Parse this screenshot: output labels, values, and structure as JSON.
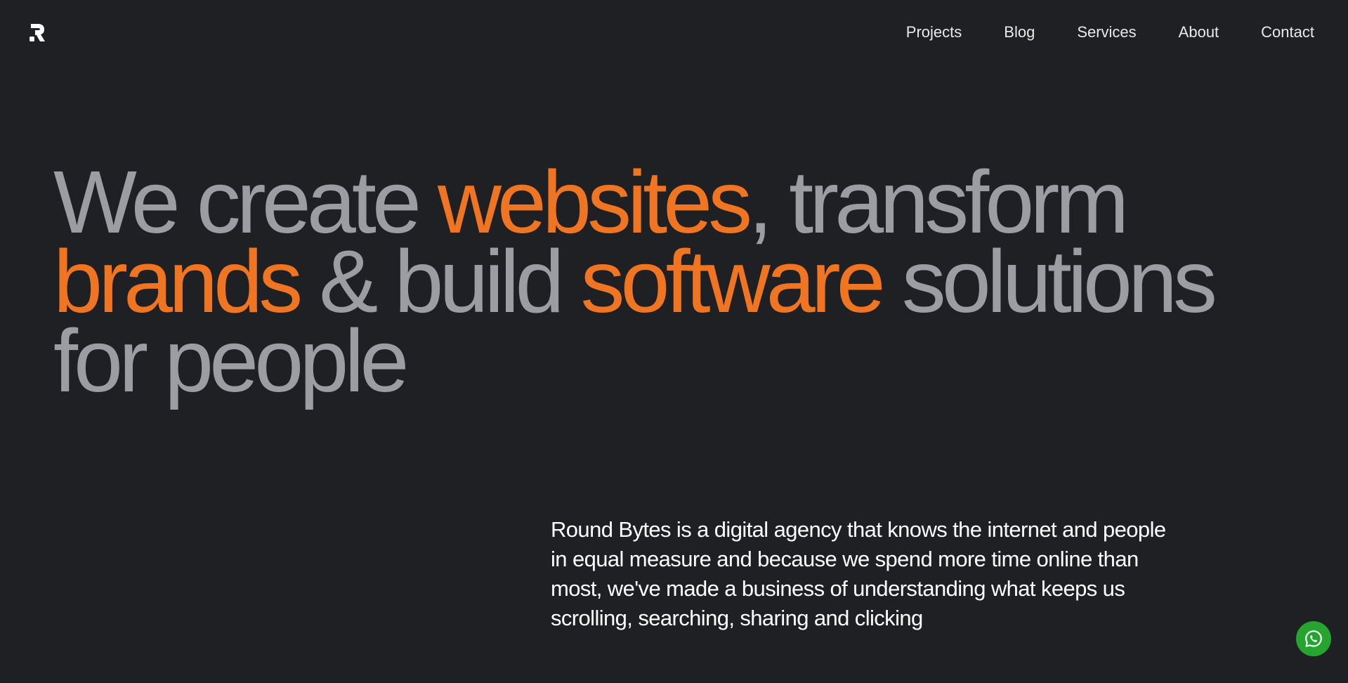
{
  "header": {
    "logo_name": "round-bytes-logo",
    "nav": {
      "items": [
        {
          "label": "Projects"
        },
        {
          "label": "Blog"
        },
        {
          "label": "Services"
        },
        {
          "label": "About"
        },
        {
          "label": "Contact"
        }
      ]
    }
  },
  "hero": {
    "line1": {
      "part1": "We create ",
      "accent1": "websites",
      "part2": ", transform"
    },
    "line2": {
      "accent1": "brands",
      "part1": " & build ",
      "accent2": "software",
      "part2": " solutions"
    },
    "line3": {
      "part1": "for people"
    }
  },
  "intro": {
    "text": "Round Bytes is a digital agency that knows the internet and people in equal measure and because we spend more time online than most, we've made a business of understanding what keeps us scrolling, searching, sharing and clicking"
  },
  "fab": {
    "icon": "whatsapp-icon"
  },
  "colors": {
    "background": "#1f2023",
    "hero_text": "#9c9da3",
    "accent": "#f07522",
    "nav_text": "#e9e9ea",
    "body_text": "#ffffff",
    "whatsapp_green": "#25a42f"
  }
}
